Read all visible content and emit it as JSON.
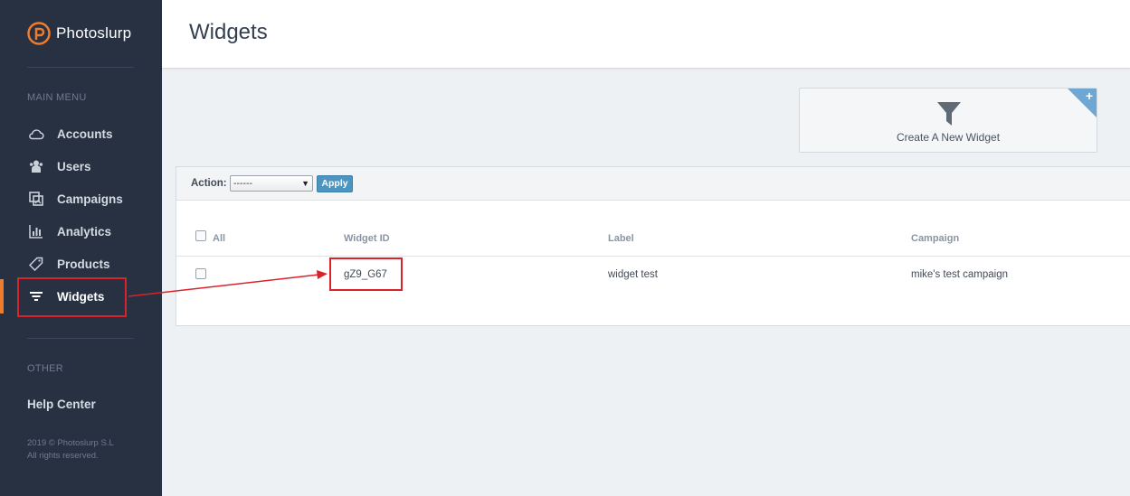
{
  "app": {
    "name": "Photoslurp"
  },
  "sidebar": {
    "main_menu_heading": "MAIN MENU",
    "items": [
      {
        "label": "Accounts",
        "icon": "cloud-icon"
      },
      {
        "label": "Users",
        "icon": "users-icon"
      },
      {
        "label": "Campaigns",
        "icon": "campaigns-icon"
      },
      {
        "label": "Analytics",
        "icon": "bar-chart-icon"
      },
      {
        "label": "Products",
        "icon": "tag-icon"
      },
      {
        "label": "Widgets",
        "icon": "filter-icon",
        "active": true
      }
    ],
    "other_heading": "OTHER",
    "help_center": "Help Center",
    "copyright": "2019 © Photoslurp S.L",
    "rights": "All rights reserved."
  },
  "header": {
    "title": "Widgets"
  },
  "create_card": {
    "label": "Create A New Widget",
    "icon": "funnel-icon",
    "corner_icon": "plus-icon"
  },
  "action_bar": {
    "label": "Action:",
    "select_value": "------",
    "apply_label": "Apply"
  },
  "table": {
    "columns": [
      "All",
      "Widget ID",
      "Label",
      "Campaign"
    ],
    "rows": [
      {
        "widget_id": "gZ9_G67",
        "label": "widget test",
        "campaign": "mike's test campaign"
      }
    ]
  },
  "colors": {
    "sidebar": "#273142",
    "accent": "#f07c2b",
    "button": "#4d94c1",
    "annotation": "#d9232a"
  }
}
